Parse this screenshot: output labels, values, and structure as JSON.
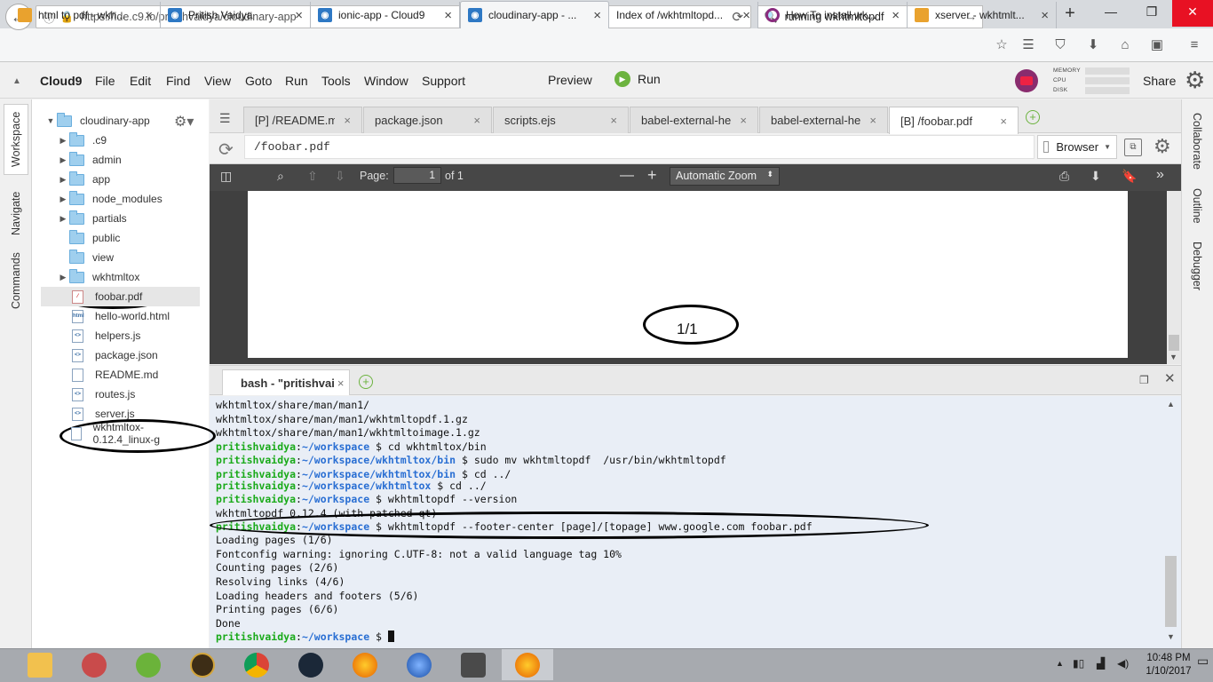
{
  "browser": {
    "tabs": [
      {
        "title": "html to pdf - wkh...",
        "icon": "folder-icon"
      },
      {
        "title": "Pritish Vaidya",
        "icon": "c9-icon"
      },
      {
        "title": "ionic-app - Cloud9",
        "icon": "c9-icon"
      },
      {
        "title": "cloudinary-app - ...",
        "icon": "c9-icon"
      },
      {
        "title": "Index of /wkhtmltopd...",
        "icon": "none"
      },
      {
        "title": "How To install wk...",
        "icon": "ring-icon"
      },
      {
        "title": "xserver - wkhtmlt...",
        "icon": "folder-icon"
      }
    ],
    "url": "https://ide.c9.io/pritishvaidya/cloudinary-app",
    "search": "running wkhtmltopdf"
  },
  "c9": {
    "brand": "Cloud9",
    "menu": [
      "File",
      "Edit",
      "Find",
      "View",
      "Goto",
      "Run",
      "Tools",
      "Window",
      "Support"
    ],
    "preview": "Preview",
    "run": "Run",
    "meters": [
      "MEMORY",
      "CPU",
      "DISK"
    ],
    "share": "Share"
  },
  "left_rail": [
    "Workspace",
    "Navigate",
    "Commands"
  ],
  "right_rail": [
    "Collaborate",
    "Outline",
    "Debugger"
  ],
  "tree": {
    "root": "cloudinary-app",
    "items": [
      {
        "name": ".c9",
        "type": "folder",
        "arrow": true
      },
      {
        "name": "admin",
        "type": "folder",
        "arrow": true
      },
      {
        "name": "app",
        "type": "folder",
        "arrow": true
      },
      {
        "name": "node_modules",
        "type": "folder",
        "arrow": true
      },
      {
        "name": "partials",
        "type": "folder",
        "arrow": true
      },
      {
        "name": "public",
        "type": "folder",
        "arrow": false
      },
      {
        "name": "view",
        "type": "folder",
        "arrow": false
      },
      {
        "name": "wkhtmltox",
        "type": "folder",
        "arrow": true
      },
      {
        "name": "foobar.pdf",
        "type": "pdf",
        "arrow": false
      },
      {
        "name": "hello-world.html",
        "type": "html",
        "arrow": false
      },
      {
        "name": "helpers.js",
        "type": "js",
        "arrow": false
      },
      {
        "name": "package.json",
        "type": "js",
        "arrow": false
      },
      {
        "name": "README.md",
        "type": "md",
        "arrow": false
      },
      {
        "name": "routes.js",
        "type": "js",
        "arrow": false
      },
      {
        "name": "server.js",
        "type": "js",
        "arrow": false
      },
      {
        "name": "wkhtmltox-0.12.4_linux-g",
        "type": "file",
        "arrow": false
      }
    ]
  },
  "editor_tabs": [
    "[P] /README.m",
    "package.json",
    "scripts.ejs",
    "babel-external-he",
    "babel-external-he",
    "[B] /foobar.pdf"
  ],
  "preview_bar": {
    "path": "/foobar.pdf",
    "browser": "Browser"
  },
  "pdf": {
    "page_label": "Page:",
    "page": "1",
    "of": "of 1",
    "zoom": "Automatic Zoom",
    "page_text": "1/1"
  },
  "terminal": {
    "tab": "bash - \"pritishvai",
    "lines": [
      [
        [
          "t",
          "wkhtmltox/share/man/man1/"
        ]
      ],
      [
        [
          "t",
          "wkhtmltox/share/man/man1/wkhtmltopdf.1.gz"
        ]
      ],
      [
        [
          "t",
          "wkhtmltox/share/man/man1/wkhtmltoimage.1.gz"
        ]
      ],
      [
        [
          "u",
          "pritishvaidya"
        ],
        [
          "t",
          ":"
        ],
        [
          "p",
          "~/workspace"
        ],
        [
          "t",
          " $ cd wkhtmltox/bin"
        ]
      ],
      [
        [
          "u",
          "pritishvaidya"
        ],
        [
          "t",
          ":"
        ],
        [
          "p",
          "~/workspace/wkhtmltox/bin"
        ],
        [
          "t",
          " $ sudo mv wkhtmltopdf  /usr/bin/wkhtmltopdf"
        ]
      ],
      [
        [
          "u",
          "pritishvaidya"
        ],
        [
          "t",
          ":"
        ],
        [
          "p",
          "~/workspace/wkhtmltox/bin"
        ],
        [
          "t",
          " $ cd ../"
        ]
      ],
      [
        [
          "u",
          "pritishvaidya"
        ],
        [
          "t",
          ":"
        ],
        [
          "p",
          "~/workspace/wkhtmltox"
        ],
        [
          "t",
          " $ cd ../"
        ]
      ],
      [
        [
          "u",
          "pritishvaidya"
        ],
        [
          "t",
          ":"
        ],
        [
          "p",
          "~/workspace"
        ],
        [
          "t",
          " $ wkhtmltopdf --version"
        ]
      ],
      [
        [
          "t",
          "wkhtmltopdf 0.12.4 (with patched qt)"
        ]
      ],
      [
        [
          "u",
          "pritishvaidya"
        ],
        [
          "t",
          ":"
        ],
        [
          "p",
          "~/workspace"
        ],
        [
          "t",
          " $ wkhtmltopdf --footer-center [page]/[topage] www.google.com foobar.pdf"
        ]
      ],
      [
        [
          "t",
          "Loading pages (1/6)"
        ]
      ],
      [
        [
          "t",
          "Fontconfig warning: ignoring C.UTF-8: not a valid language tag 10%"
        ]
      ],
      [
        [
          "t",
          "Counting pages (2/6)"
        ]
      ],
      [
        [
          "t",
          "Resolving links (4/6)"
        ]
      ],
      [
        [
          "t",
          "Loading headers and footers (5/6)"
        ]
      ],
      [
        [
          "t",
          "Printing pages (6/6)"
        ]
      ],
      [
        [
          "t",
          "Done"
        ]
      ],
      [
        [
          "u",
          "pritishvaidya"
        ],
        [
          "t",
          ":"
        ],
        [
          "p",
          "~/workspace"
        ],
        [
          "t",
          " $ "
        ]
      ]
    ]
  },
  "taskbar": {
    "apps": [
      "file-explorer-icon",
      "rocket-icon",
      "utorrent-icon",
      "warcraft-icon",
      "chrome-icon",
      "steam-icon",
      "firefox-icon",
      "thunderbird-icon",
      "sublime-icon",
      "firefox-active-icon"
    ],
    "time": "10:48 PM",
    "date": "1/10/2017"
  },
  "colors": {
    "prompt_user": "#1aaa1a",
    "prompt_path": "#2a6fd3",
    "run_green": "#6cb33f",
    "pdf_toolbar": "#474747"
  }
}
